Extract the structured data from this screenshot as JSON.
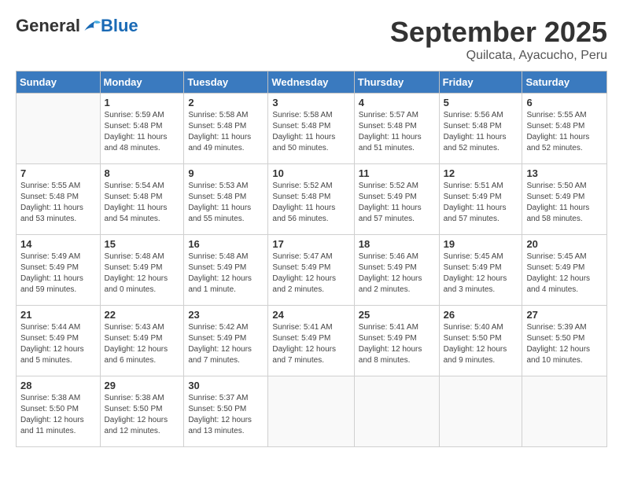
{
  "logo": {
    "general": "General",
    "blue": "Blue"
  },
  "title": "September 2025",
  "subtitle": "Quilcata, Ayacucho, Peru",
  "days_of_week": [
    "Sunday",
    "Monday",
    "Tuesday",
    "Wednesday",
    "Thursday",
    "Friday",
    "Saturday"
  ],
  "weeks": [
    [
      {
        "num": "",
        "sunrise": "",
        "sunset": "",
        "daylight": ""
      },
      {
        "num": "1",
        "sunrise": "Sunrise: 5:59 AM",
        "sunset": "Sunset: 5:48 PM",
        "daylight": "Daylight: 11 hours and 48 minutes."
      },
      {
        "num": "2",
        "sunrise": "Sunrise: 5:58 AM",
        "sunset": "Sunset: 5:48 PM",
        "daylight": "Daylight: 11 hours and 49 minutes."
      },
      {
        "num": "3",
        "sunrise": "Sunrise: 5:58 AM",
        "sunset": "Sunset: 5:48 PM",
        "daylight": "Daylight: 11 hours and 50 minutes."
      },
      {
        "num": "4",
        "sunrise": "Sunrise: 5:57 AM",
        "sunset": "Sunset: 5:48 PM",
        "daylight": "Daylight: 11 hours and 51 minutes."
      },
      {
        "num": "5",
        "sunrise": "Sunrise: 5:56 AM",
        "sunset": "Sunset: 5:48 PM",
        "daylight": "Daylight: 11 hours and 52 minutes."
      },
      {
        "num": "6",
        "sunrise": "Sunrise: 5:55 AM",
        "sunset": "Sunset: 5:48 PM",
        "daylight": "Daylight: 11 hours and 52 minutes."
      }
    ],
    [
      {
        "num": "7",
        "sunrise": "Sunrise: 5:55 AM",
        "sunset": "Sunset: 5:48 PM",
        "daylight": "Daylight: 11 hours and 53 minutes."
      },
      {
        "num": "8",
        "sunrise": "Sunrise: 5:54 AM",
        "sunset": "Sunset: 5:48 PM",
        "daylight": "Daylight: 11 hours and 54 minutes."
      },
      {
        "num": "9",
        "sunrise": "Sunrise: 5:53 AM",
        "sunset": "Sunset: 5:48 PM",
        "daylight": "Daylight: 11 hours and 55 minutes."
      },
      {
        "num": "10",
        "sunrise": "Sunrise: 5:52 AM",
        "sunset": "Sunset: 5:48 PM",
        "daylight": "Daylight: 11 hours and 56 minutes."
      },
      {
        "num": "11",
        "sunrise": "Sunrise: 5:52 AM",
        "sunset": "Sunset: 5:49 PM",
        "daylight": "Daylight: 11 hours and 57 minutes."
      },
      {
        "num": "12",
        "sunrise": "Sunrise: 5:51 AM",
        "sunset": "Sunset: 5:49 PM",
        "daylight": "Daylight: 11 hours and 57 minutes."
      },
      {
        "num": "13",
        "sunrise": "Sunrise: 5:50 AM",
        "sunset": "Sunset: 5:49 PM",
        "daylight": "Daylight: 11 hours and 58 minutes."
      }
    ],
    [
      {
        "num": "14",
        "sunrise": "Sunrise: 5:49 AM",
        "sunset": "Sunset: 5:49 PM",
        "daylight": "Daylight: 11 hours and 59 minutes."
      },
      {
        "num": "15",
        "sunrise": "Sunrise: 5:48 AM",
        "sunset": "Sunset: 5:49 PM",
        "daylight": "Daylight: 12 hours and 0 minutes."
      },
      {
        "num": "16",
        "sunrise": "Sunrise: 5:48 AM",
        "sunset": "Sunset: 5:49 PM",
        "daylight": "Daylight: 12 hours and 1 minute."
      },
      {
        "num": "17",
        "sunrise": "Sunrise: 5:47 AM",
        "sunset": "Sunset: 5:49 PM",
        "daylight": "Daylight: 12 hours and 2 minutes."
      },
      {
        "num": "18",
        "sunrise": "Sunrise: 5:46 AM",
        "sunset": "Sunset: 5:49 PM",
        "daylight": "Daylight: 12 hours and 2 minutes."
      },
      {
        "num": "19",
        "sunrise": "Sunrise: 5:45 AM",
        "sunset": "Sunset: 5:49 PM",
        "daylight": "Daylight: 12 hours and 3 minutes."
      },
      {
        "num": "20",
        "sunrise": "Sunrise: 5:45 AM",
        "sunset": "Sunset: 5:49 PM",
        "daylight": "Daylight: 12 hours and 4 minutes."
      }
    ],
    [
      {
        "num": "21",
        "sunrise": "Sunrise: 5:44 AM",
        "sunset": "Sunset: 5:49 PM",
        "daylight": "Daylight: 12 hours and 5 minutes."
      },
      {
        "num": "22",
        "sunrise": "Sunrise: 5:43 AM",
        "sunset": "Sunset: 5:49 PM",
        "daylight": "Daylight: 12 hours and 6 minutes."
      },
      {
        "num": "23",
        "sunrise": "Sunrise: 5:42 AM",
        "sunset": "Sunset: 5:49 PM",
        "daylight": "Daylight: 12 hours and 7 minutes."
      },
      {
        "num": "24",
        "sunrise": "Sunrise: 5:41 AM",
        "sunset": "Sunset: 5:49 PM",
        "daylight": "Daylight: 12 hours and 7 minutes."
      },
      {
        "num": "25",
        "sunrise": "Sunrise: 5:41 AM",
        "sunset": "Sunset: 5:49 PM",
        "daylight": "Daylight: 12 hours and 8 minutes."
      },
      {
        "num": "26",
        "sunrise": "Sunrise: 5:40 AM",
        "sunset": "Sunset: 5:50 PM",
        "daylight": "Daylight: 12 hours and 9 minutes."
      },
      {
        "num": "27",
        "sunrise": "Sunrise: 5:39 AM",
        "sunset": "Sunset: 5:50 PM",
        "daylight": "Daylight: 12 hours and 10 minutes."
      }
    ],
    [
      {
        "num": "28",
        "sunrise": "Sunrise: 5:38 AM",
        "sunset": "Sunset: 5:50 PM",
        "daylight": "Daylight: 12 hours and 11 minutes."
      },
      {
        "num": "29",
        "sunrise": "Sunrise: 5:38 AM",
        "sunset": "Sunset: 5:50 PM",
        "daylight": "Daylight: 12 hours and 12 minutes."
      },
      {
        "num": "30",
        "sunrise": "Sunrise: 5:37 AM",
        "sunset": "Sunset: 5:50 PM",
        "daylight": "Daylight: 12 hours and 13 minutes."
      },
      {
        "num": "",
        "sunrise": "",
        "sunset": "",
        "daylight": ""
      },
      {
        "num": "",
        "sunrise": "",
        "sunset": "",
        "daylight": ""
      },
      {
        "num": "",
        "sunrise": "",
        "sunset": "",
        "daylight": ""
      },
      {
        "num": "",
        "sunrise": "",
        "sunset": "",
        "daylight": ""
      }
    ]
  ]
}
